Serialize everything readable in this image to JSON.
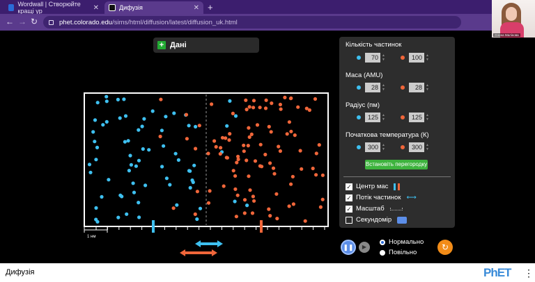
{
  "browser": {
    "tabs": [
      {
        "label": "Wordwall | Створюйте кращі ур",
        "active": false
      },
      {
        "label": "Дифузія",
        "active": true
      }
    ],
    "url_host": "phet.colorado.edu",
    "url_path": "/sims/html/diffusion/latest/diffusion_uk.html",
    "camera_name": "Олена Малінова"
  },
  "sim": {
    "data_label": "Дані",
    "scale_label": "1 нм",
    "panel": {
      "count_label": "Кількість частинок",
      "count_left": "70",
      "count_right": "100",
      "mass_label": "Маса (AMU)",
      "mass_left": "28",
      "mass_right": "28",
      "radius_label": "Радіус (пм)",
      "radius_left": "125",
      "radius_right": "125",
      "temp_label": "Початкова температура (К)",
      "temp_left": "300",
      "temp_right": "300",
      "partition_button": "Встановіть перегородку",
      "center_of_mass": "Центр мас",
      "particle_flow": "Потік частинок",
      "scale": "Масштаб",
      "stopwatch": "Секундомір"
    },
    "checks": {
      "center_of_mass": true,
      "particle_flow": true,
      "scale": true,
      "stopwatch": false
    },
    "speed": {
      "normal": "Нормально",
      "slow": "Повільно",
      "selected": "normal"
    },
    "colors": {
      "blue": "#3ec0f0",
      "orange": "#f0663a"
    }
  },
  "footer": {
    "title": "Дифузія",
    "logo": "PhET"
  }
}
